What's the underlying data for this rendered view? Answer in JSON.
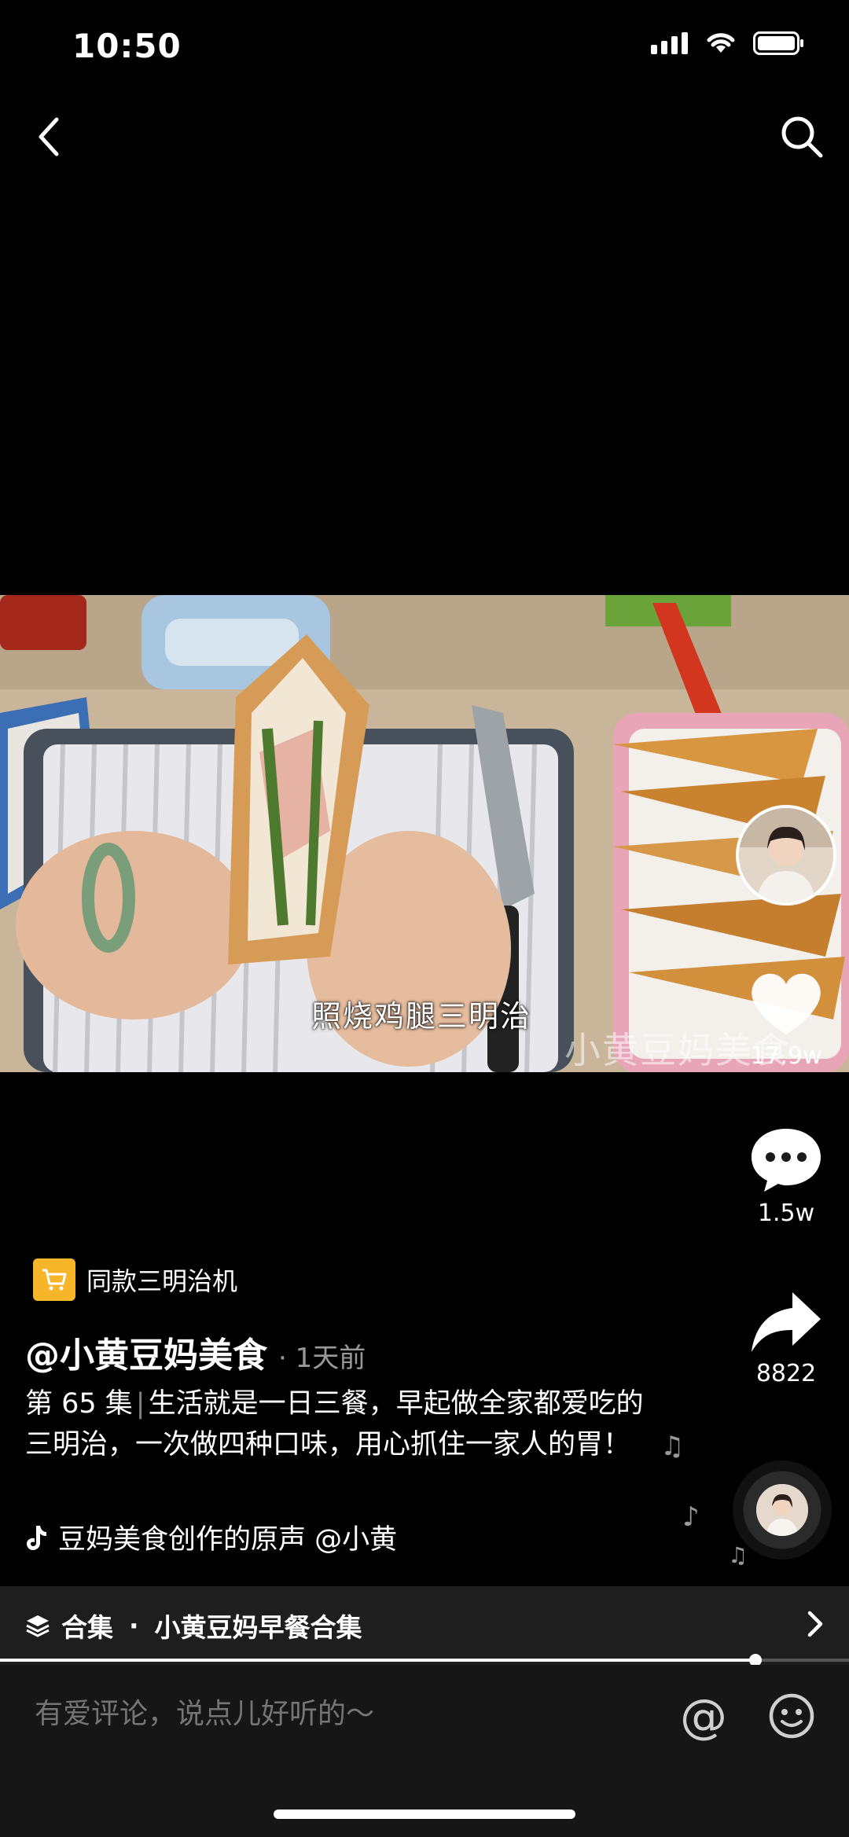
{
  "status_bar": {
    "time": "10:50"
  },
  "video": {
    "subtitle": "照烧鸡腿三明治",
    "watermark": "小黄豆妈美食",
    "progress": 0.89
  },
  "rail": {
    "like_count": "17.9w",
    "comment_count": "1.5w",
    "share_count": "8822"
  },
  "shop": {
    "label": "同款三明治机"
  },
  "author": {
    "name": "@小黄豆妈美食",
    "time": "· 1天前"
  },
  "caption": {
    "episode": "第 65 集",
    "text": "生活就是一日三餐，早起做全家都爱吃的三明治，一次做四种口味，用心抓住一家人的胃！"
  },
  "music": {
    "text": "豆妈美食创作的原声    @小黄"
  },
  "collection": {
    "prefix": "合集",
    "title": "小黄豆妈早餐合集"
  },
  "comment_bar": {
    "placeholder": "有爱评论，说点儿好听的～"
  },
  "colors": {
    "shop_tag": "#f7b529",
    "background": "#000000"
  },
  "icons": [
    "back-icon",
    "search-icon",
    "heart-icon",
    "comment-icon",
    "share-icon",
    "tiktok-note-icon",
    "layers-icon",
    "chevron-right-icon",
    "at-icon",
    "emoji-icon"
  ]
}
